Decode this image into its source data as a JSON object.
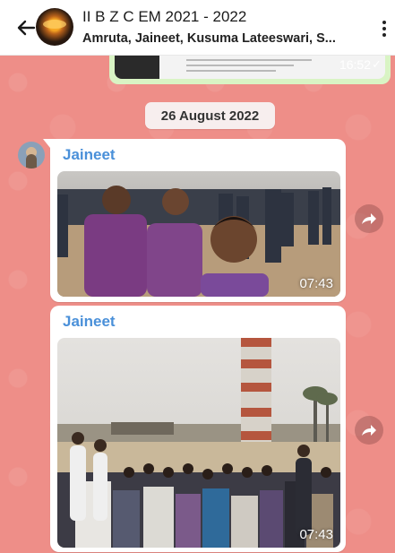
{
  "header": {
    "title": "II B Z C EM 2021 - 2022",
    "subtitle": "Amruta, Jaineet, Kusuma Lateeswari, S..."
  },
  "previous_message": {
    "time": "16:52",
    "status": "read"
  },
  "date_separator": "26 August 2022",
  "messages": [
    {
      "sender": "Jaineet",
      "type": "video",
      "duration": "07:43"
    },
    {
      "sender": "Jaineet",
      "type": "video",
      "duration": "07:43"
    }
  ],
  "colors": {
    "chat_background": "#ee8e88",
    "sender_name": "#4a90d9",
    "bubble": "#ffffff",
    "date_chip": "#f7eeee"
  },
  "icons": [
    "back-arrow-icon",
    "more-options-icon",
    "forward-icon",
    "double-check-icon"
  ]
}
